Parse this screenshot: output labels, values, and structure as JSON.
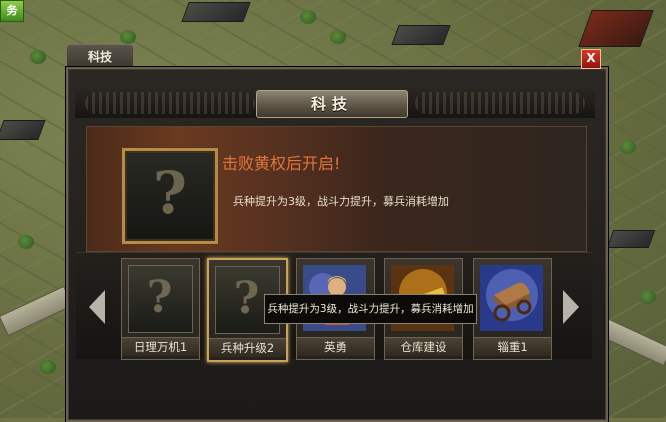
{
  "hud": {
    "corner_label": "务"
  },
  "window": {
    "tab_label": "科技",
    "title": "科技",
    "close_label": "X"
  },
  "selected_tech": {
    "icon": "unknown-question-icon",
    "unlock_text": "击败黄权后开启!",
    "description": "兵种提升为3级，战斗力提升，募兵消耗增加"
  },
  "tech_cards": [
    {
      "label": "日理万机1",
      "icon": "question-icon",
      "locked": true
    },
    {
      "label": "兵种升级2",
      "icon": "question-icon",
      "locked": true,
      "selected": true
    },
    {
      "label": "英勇",
      "icon": "warrior-portrait-icon",
      "locked": false
    },
    {
      "label": "仓库建设",
      "icon": "warehouse-gold-icon",
      "locked": false
    },
    {
      "label": "辎重1",
      "icon": "supply-cart-icon",
      "locked": false
    }
  ],
  "tooltip": {
    "text": "兵种提升为3级，战斗力提升，募兵消耗增加"
  },
  "colors": {
    "unlock_text": "#e2763a",
    "frame_gold": "#b98a45",
    "close_red": "#c8281c"
  }
}
